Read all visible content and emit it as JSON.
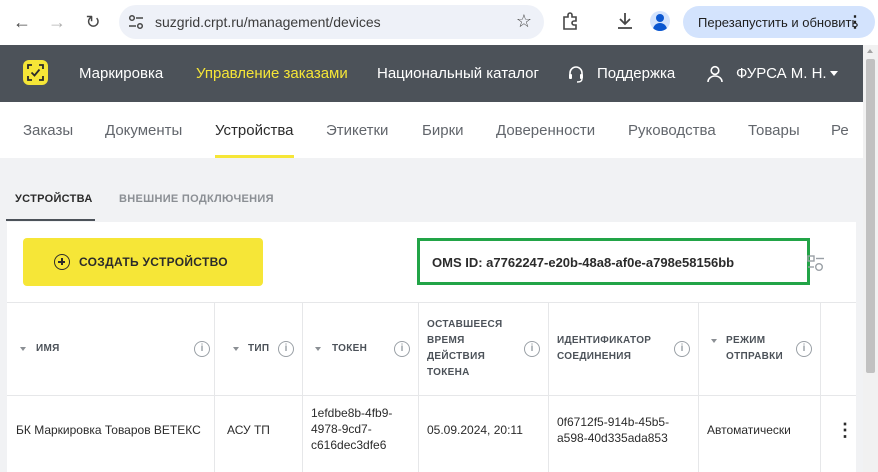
{
  "browser": {
    "url": "suzgrid.crpt.ru/management/devices",
    "relaunch_label": "Перезапустить и обновить",
    "icons": [
      "back-icon",
      "forward-icon",
      "reload-icon",
      "site-settings-icon",
      "star-icon",
      "extensions-icon",
      "download-icon",
      "profile-icon",
      "more-icon"
    ]
  },
  "header": {
    "nav": [
      "Маркировка",
      "Управление заказами",
      "Национальный каталог"
    ],
    "active_index": 1,
    "support": "Поддержка",
    "user": "ФУРСА М. Н.",
    "accent_color": "#f6e637",
    "bg_color": "#4c5259"
  },
  "subnav": {
    "tabs": [
      "Заказы",
      "Документы",
      "Устройства",
      "Этикетки",
      "Бирки",
      "Доверенности",
      "Руководства",
      "Товары",
      "Ре"
    ],
    "active_index": 2
  },
  "section_tabs": [
    "УСТРОЙСТВА",
    "ВНЕШНИЕ ПОДКЛЮЧЕНИЯ"
  ],
  "toolbar": {
    "create_label": "СОЗДАТЬ УСТРОЙСТВО",
    "oms_id": "OMS ID: a7762247-e20b-48a8-af0e-a798e58156bb",
    "highlight_color": "#22a447"
  },
  "table": {
    "headers": [
      "ИМЯ",
      "ТИП",
      "ТОКЕН",
      "ОСТАВШЕЕСЯ ВРЕМЯ ДЕЙСТВИЯ ТОКЕНА",
      "ИДЕНТИФИКАТОР СОЕДИНЕНИЯ",
      "РЕЖИМ ОТПРАВКИ"
    ],
    "rows": [
      {
        "name": "БК Маркировка Товаров ВЕТЕКС",
        "type": "АСУ ТП",
        "token": "1efdbe8b-4fb9-4978-9cd7-c616dec3dfe6",
        "expires": "05.09.2024, 20:11",
        "connection_id": "0f6712f5-914b-45b5-a598-40d335ada853",
        "mode": "Автоматически"
      }
    ]
  }
}
